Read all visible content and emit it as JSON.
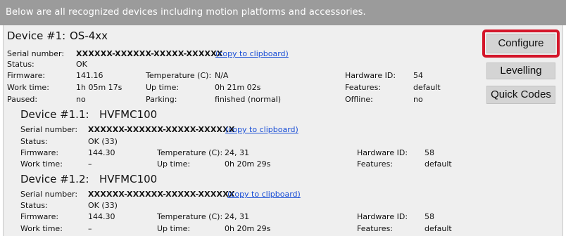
{
  "header": {
    "text": "Below are all recognized devices including motion platforms and accessories."
  },
  "buttons": {
    "configure": "Configure",
    "levelling": "Levelling",
    "quick_codes": "Quick Codes"
  },
  "copy_link": "(copy to clipboard)",
  "device1": {
    "title": "Device #1:",
    "model": "OS-4xx",
    "serial_label": "Serial number:",
    "serial": "XXXXXX-XXXXXX-XXXXX-XXXXXX",
    "status_label": "Status:",
    "status": "OK",
    "firmware_label": "Firmware:",
    "firmware": "141.16",
    "temp_label": "Temperature (C):",
    "temp": "N/A",
    "hwid_label": "Hardware ID:",
    "hwid": "54",
    "worktime_label": "Work time:",
    "worktime": "1h 05m 17s",
    "uptime_label": "Up time:",
    "uptime": "0h 21m 02s",
    "features_label": "Features:",
    "features": "default",
    "paused_label": "Paused:",
    "paused": "no",
    "parking_label": "Parking:",
    "parking": "finished (normal)",
    "offline_label": "Offline:",
    "offline": "no"
  },
  "device11": {
    "title": "Device #1.1:",
    "model": "HVFMC100",
    "serial_label": "Serial number:",
    "serial": "XXXXXX-XXXXXX-XXXXX-XXXXXX",
    "status_label": "Status:",
    "status": "OK (33)",
    "firmware_label": "Firmware:",
    "firmware": "144.30",
    "temp_label": "Temperature (C):",
    "temp": "24, 31",
    "hwid_label": "Hardware ID:",
    "hwid": "58",
    "worktime_label": "Work time:",
    "worktime": "–",
    "uptime_label": "Up time:",
    "uptime": "0h 20m 29s",
    "features_label": "Features:",
    "features": "default"
  },
  "device12": {
    "title": "Device #1.2:",
    "model": "HVFMC100",
    "serial_label": "Serial number:",
    "serial": "XXXXXX-XXXXXX-XXXXX-XXXXXX",
    "status_label": "Status:",
    "status": "OK (33)",
    "firmware_label": "Firmware:",
    "firmware": "144.30",
    "temp_label": "Temperature (C):",
    "temp": "24, 31",
    "hwid_label": "Hardware ID:",
    "hwid": "58",
    "worktime_label": "Work time:",
    "worktime": "–",
    "uptime_label": "Up time:",
    "uptime": "0h 20m 29s",
    "features_label": "Features:",
    "features": "default"
  }
}
